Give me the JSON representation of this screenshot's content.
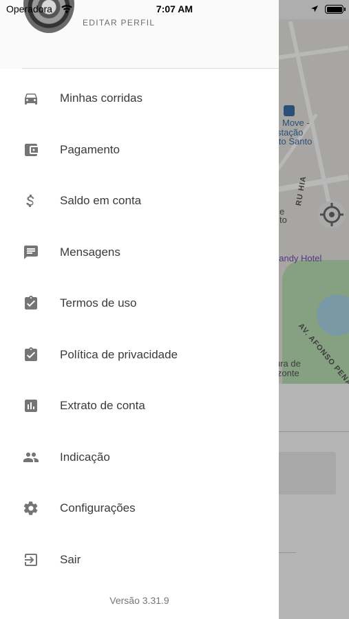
{
  "status_bar": {
    "carrier": "Operadora",
    "time": "7:07 AM"
  },
  "profile": {
    "edit_label": "EDITAR PERFIL"
  },
  "menu": {
    "items": [
      {
        "label": "Minhas corridas",
        "icon": "car-icon"
      },
      {
        "label": "Pagamento",
        "icon": "wallet-icon"
      },
      {
        "label": "Saldo em conta",
        "icon": "dollar-icon"
      },
      {
        "label": "Mensagens",
        "icon": "message-icon"
      },
      {
        "label": "Termos de uso",
        "icon": "clipboard-check-icon"
      },
      {
        "label": "Política de privacidade",
        "icon": "clipboard-check-icon"
      },
      {
        "label": "Extrato de conta",
        "icon": "bar-chart-icon"
      },
      {
        "label": "Indicação",
        "icon": "people-icon"
      },
      {
        "label": "Configurações",
        "icon": "gear-icon"
      },
      {
        "label": "Sair",
        "icon": "exit-icon"
      }
    ]
  },
  "version": "Versão 3.31.9",
  "map": {
    "labels": {
      "move": "Move -",
      "estacao": "stação",
      "espirito_santo": "ito Santo",
      "e": "e",
      "to": "to",
      "hotel": "handy Hotel",
      "rua_bahia": "RU  HIA",
      "afonso_pena": "AV. AFONSO PENA",
      "ura_de": "ura de",
      "izonte": "izonte"
    }
  },
  "colors": {
    "icon": "#757575",
    "text": "#3a3a3a",
    "map_link": "#3a6ea8",
    "hotel": "#7b4db5"
  }
}
